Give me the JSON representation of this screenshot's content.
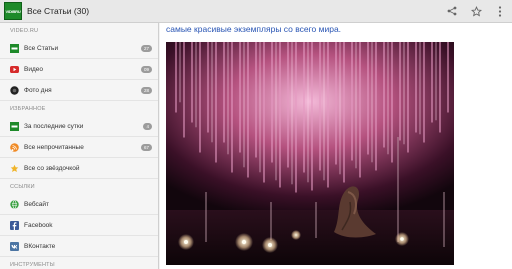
{
  "app": {
    "logo_text": "VIDIBRU",
    "title": "Все Статьи (30)"
  },
  "actions": {
    "share_icon": "share-icon",
    "star_icon": "star-outline-icon",
    "overflow_icon": "more-vert-icon"
  },
  "drawer": {
    "sections": [
      {
        "header": "VIDEO.RU",
        "items": [
          {
            "label": "Все Статьи",
            "count": "27",
            "icon": "vidiru-logo-icon"
          },
          {
            "label": "Видео",
            "count": "09",
            "icon": "youtube-icon"
          },
          {
            "label": "Фото дня",
            "count": "28",
            "icon": "camera-icon"
          }
        ]
      },
      {
        "header": "ИЗБРАННОЕ",
        "items": [
          {
            "label": "За последние сутки",
            "count": "4",
            "icon": "vidiru-logo-icon"
          },
          {
            "label": "Все непрочитанные",
            "count": "67",
            "icon": "rss-icon"
          },
          {
            "label": "Все со звёздочкой",
            "count": "",
            "icon": "star-icon"
          }
        ]
      },
      {
        "header": "ССЫЛКИ",
        "items": [
          {
            "label": "Вебсайт",
            "count": "",
            "icon": "globe-icon"
          },
          {
            "label": "Facebook",
            "count": "",
            "icon": "facebook-icon"
          },
          {
            "label": "ВКонтакте",
            "count": "",
            "icon": "vk-icon"
          }
        ]
      },
      {
        "header": "ИНСТРУМЕНТЫ",
        "items": []
      }
    ]
  },
  "article": {
    "text": "самые красивые экземпляры со всего мира.",
    "image_subject": "wisteria tree photo"
  },
  "colors": {
    "accent_text": "#2955b4",
    "logo_green": "#1e8a2a",
    "youtube_red": "#d62b2b",
    "rss_orange": "#f08a24",
    "star_gold": "#f0b429",
    "facebook_blue": "#3b5998",
    "vk_blue": "#4c75a3"
  }
}
